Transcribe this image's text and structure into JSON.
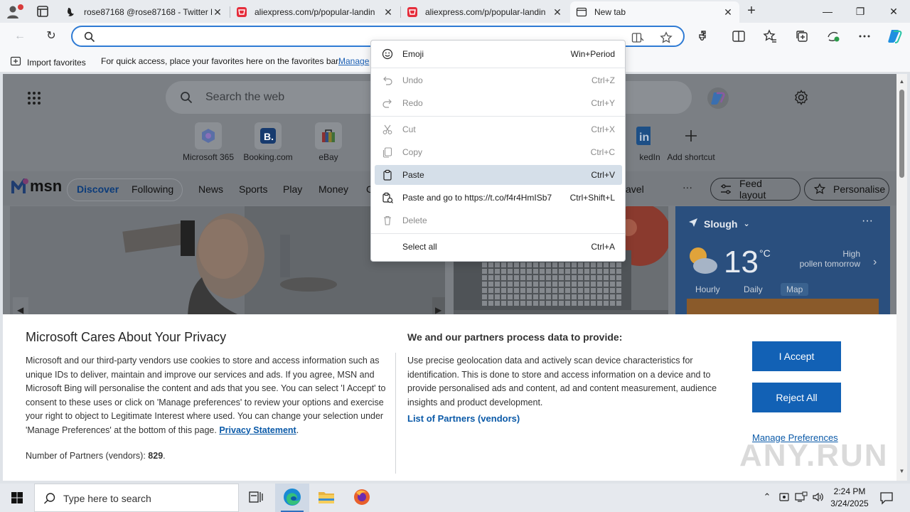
{
  "tabs": [
    {
      "title": "rose87168 @rose87168 - Twitter P",
      "icon": "twitter-favicon"
    },
    {
      "title": "aliexpress.com/p/popular-landin",
      "icon": "aliexpress-favicon"
    },
    {
      "title": "aliexpress.com/p/popular-landin",
      "icon": "aliexpress-favicon"
    },
    {
      "title": "New tab",
      "icon": "new-tab-favicon"
    }
  ],
  "window_controls": {
    "minimize": "—",
    "maximize": "❐",
    "close": "✕"
  },
  "toolbar": {
    "back": "←",
    "refresh": "↻",
    "address_value": ""
  },
  "favorites_bar": {
    "import_label": "Import favorites",
    "message": "For quick access, place your favorites here on the favorites bar.",
    "manage_link": "Manage"
  },
  "context_menu": {
    "items": [
      {
        "label": "Emoji",
        "shortcut": "Win+Period",
        "icon": "emoji-icon",
        "disabled": false
      },
      {
        "label": "Undo",
        "shortcut": "Ctrl+Z",
        "icon": "undo-icon",
        "disabled": true
      },
      {
        "label": "Redo",
        "shortcut": "Ctrl+Y",
        "icon": "redo-icon",
        "disabled": true
      },
      {
        "label": "Cut",
        "shortcut": "Ctrl+X",
        "icon": "cut-icon",
        "disabled": true
      },
      {
        "label": "Copy",
        "shortcut": "Ctrl+C",
        "icon": "copy-icon",
        "disabled": true
      },
      {
        "label": "Paste",
        "shortcut": "Ctrl+V",
        "icon": "paste-icon",
        "disabled": false,
        "highlighted": true
      },
      {
        "label": "Paste and go to https://t.co/f4r4HmISb7",
        "shortcut": "Ctrl+Shift+L",
        "icon": "paste-go-icon",
        "disabled": false
      },
      {
        "label": "Delete",
        "shortcut": "",
        "icon": "delete-icon",
        "disabled": true
      },
      {
        "label": "Select all",
        "shortcut": "Ctrl+A",
        "icon": "",
        "disabled": false
      }
    ]
  },
  "ntp": {
    "search_placeholder": "Search the web",
    "shortcuts": [
      {
        "label": "Microsoft 365",
        "icon": "microsoft-365-icon"
      },
      {
        "label": "Booking.com",
        "icon": "booking-icon"
      },
      {
        "label": "eBay",
        "icon": "ebay-icon"
      },
      {
        "label": "kedIn",
        "icon": "linkedin-icon"
      },
      {
        "label": "Add shortcut",
        "icon": "plus-icon"
      }
    ],
    "msn": {
      "logo": "msn",
      "tabs": [
        "Discover",
        "Following",
        "News",
        "Sports",
        "Play",
        "Money",
        "C",
        "avel"
      ],
      "selected_tab": "Discover",
      "more": "···",
      "feed_layout": "Feed layout",
      "personalise": "Personalise"
    },
    "weather": {
      "location": "Slough",
      "temperature": "13",
      "unit": "°C",
      "pollen_line1": "High",
      "pollen_line2": "pollen tomorrow",
      "tabs": [
        "Hourly",
        "Daily",
        "Map"
      ],
      "selected": "Map",
      "more": "···"
    }
  },
  "privacy": {
    "title": "Microsoft Cares About Your Privacy",
    "body": "Microsoft and our third-party vendors use cookies to store and access information such as unique IDs to deliver, maintain and improve our services and ads. If you agree, MSN and Microsoft Bing will personalise the content and ads that you see. You can select 'I Accept' to consent to these uses or click on 'Manage preferences' to review your options and exercise your right to object to Legitimate Interest where used. You can change your selection under 'Manage Preferences' at the bottom of this page.",
    "privacy_link": "Privacy Statement",
    "partners_label": "Number of Partners (vendors):",
    "partners_count": "829",
    "right_heading": "We and our partners process data to provide:",
    "right_body": "Use precise geolocation data and actively scan device characteristics for identification. This is done to store and access information on a device and to provide personalised ads and content, ad and content measurement, audience insights and product development.",
    "list_partners": "List of Partners (vendors)",
    "accept": "I Accept",
    "reject": "Reject All",
    "manage": "Manage Preferences",
    "watermark": "ANY.RUN"
  },
  "taskbar": {
    "search_placeholder": "Type here to search",
    "time": "2:24 PM",
    "date": "3/24/2025"
  },
  "colors": {
    "accent": "#1261b5",
    "address_border": "#2f7bd4",
    "link": "#0b5aa8"
  }
}
